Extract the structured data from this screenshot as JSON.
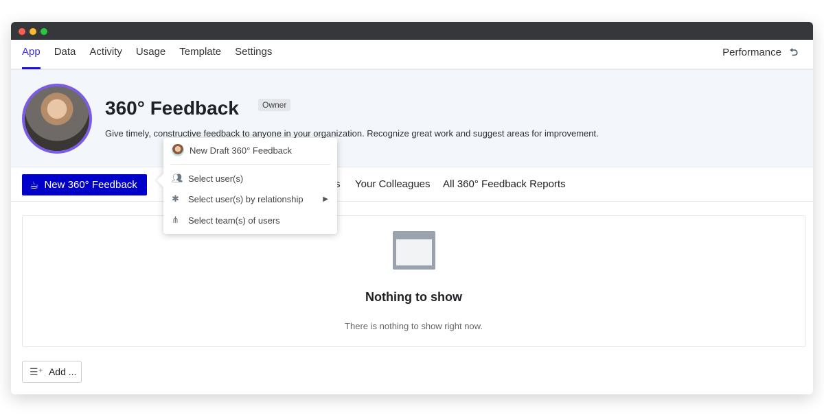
{
  "nav": {
    "tabs": [
      "App",
      "Data",
      "Activity",
      "Usage",
      "Template",
      "Settings"
    ],
    "active": "App",
    "right_label": "Performance"
  },
  "hero": {
    "title": "360° Feedback",
    "badge": "Owner",
    "description": "Give timely, constructive feedback to anyone in your organization. Recognize great work and suggest areas for improvement."
  },
  "toolbar": {
    "new_button": "New 360° Feedback",
    "tabs": [
      "s",
      "Your Colleagues",
      "All 360° Feedback Reports"
    ]
  },
  "menu": {
    "draft": "New Draft 360° Feedback",
    "items": [
      "Select user(s)",
      "Select user(s) by relationship",
      "Select team(s) of users"
    ]
  },
  "empty": {
    "title": "Nothing to show",
    "subtitle": "There is nothing to show right now."
  },
  "add_button": "Add ...",
  "colors": {
    "accent": "#0000c8",
    "active_tab": "#3a2ee8",
    "avatar_ring": "#7a5ce6"
  }
}
